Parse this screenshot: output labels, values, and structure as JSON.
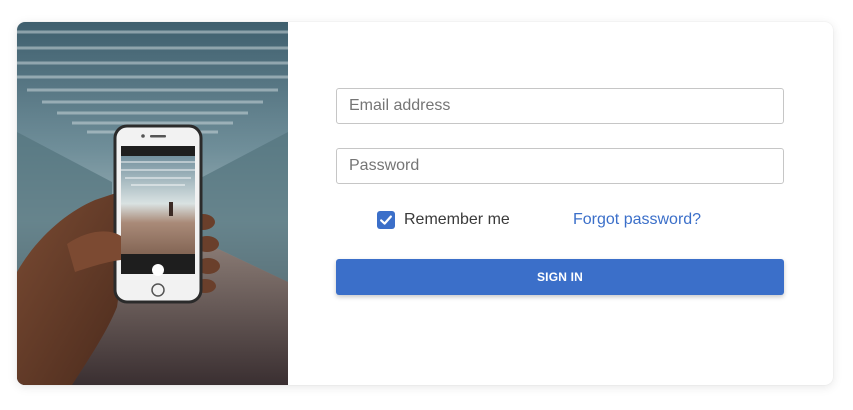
{
  "login": {
    "email_placeholder": "Email address",
    "password_placeholder": "Password",
    "remember_label": "Remember me",
    "remember_checked": true,
    "forgot_label": "Forgot password?",
    "signin_label": "SIGN IN"
  },
  "photo": {
    "subject": "hand holding smartphone photographing a covered walkway"
  },
  "colors": {
    "accent": "#3b6fc9",
    "field_border": "#c6c6c6",
    "label_text": "#3a3a3a",
    "placeholder_text": "#757575"
  }
}
